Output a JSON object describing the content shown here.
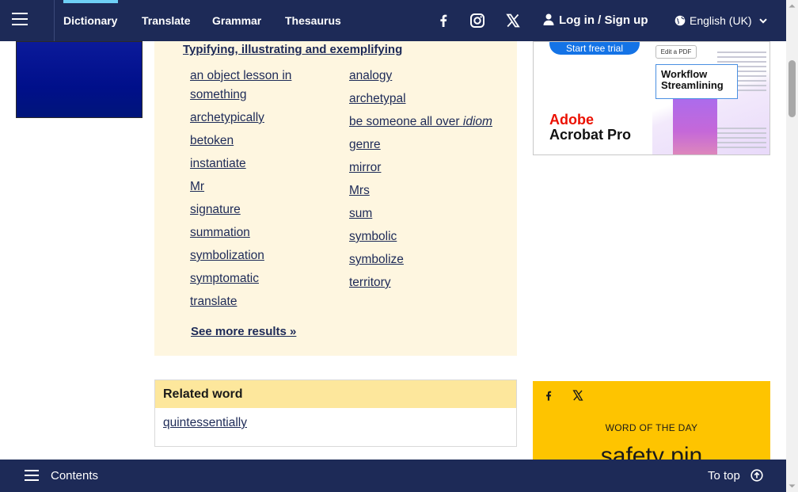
{
  "nav": {
    "tabs": [
      "Dictionary",
      "Translate",
      "Grammar",
      "Thesaurus"
    ],
    "active_tab": "Dictionary",
    "social_icons": [
      "facebook-icon",
      "instagram-icon",
      "x-icon"
    ],
    "login_label": "Log in / Sign up",
    "language_label": "English (UK)"
  },
  "synonyms": {
    "heading": "Typifying, illustrating and exemplifying",
    "left": [
      "an object lesson in something",
      "archetypically",
      "betoken",
      "instantiate",
      "Mr",
      "signature",
      "summation",
      "symbolization",
      "symptomatic",
      "translate"
    ],
    "right": [
      "analogy",
      "archetypal",
      "be someone all over",
      "genre",
      "mirror",
      "Mrs",
      "sum",
      "symbolic",
      "symbolize",
      "territory"
    ],
    "right_idiom_tag": "idiom",
    "see_more": "See more results »"
  },
  "ad": {
    "cta": "Start free trial",
    "brand_line1": "Adobe",
    "brand_line2": "Acrobat Pro",
    "edit_pdf": "Edit a PDF",
    "headline": "Workflow Streamlining"
  },
  "related": {
    "heading": "Related word",
    "word": "quintessentially"
  },
  "wotd": {
    "label": "WORD OF THE DAY",
    "word": "safety pin"
  },
  "bottom": {
    "contents_label": "Contents",
    "to_top_label": "To top"
  },
  "colors": {
    "nav_bg": "#1d2a57",
    "accent": "#6ecff6",
    "thes_bg": "#fef6e0",
    "related_head_bg": "#fde79c",
    "wotd_bg": "#fec400"
  }
}
